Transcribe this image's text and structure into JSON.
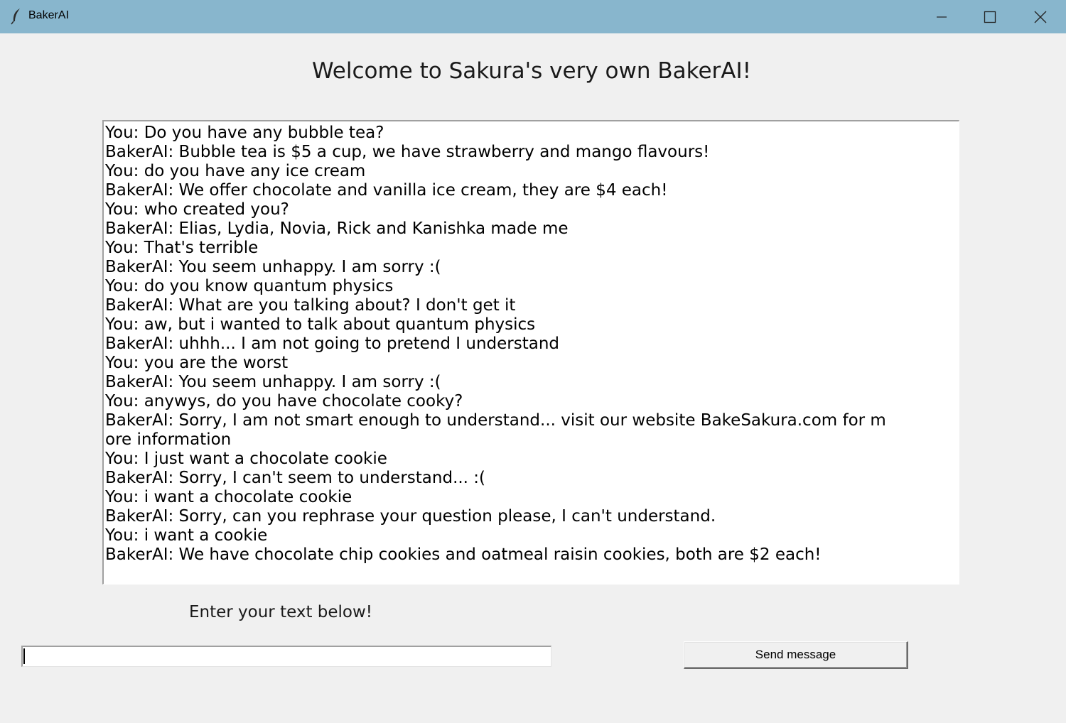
{
  "window": {
    "title": "BakerAI",
    "titlebar_color": "#88b6cd",
    "background": "#f0f0f0"
  },
  "heading": "Welcome to Sakura's very own BakerAI!",
  "chat": {
    "lines": [
      "You: Do you have any bubble tea?",
      "BakerAI: Bubble tea is $5 a cup, we have strawberry and mango flavours!",
      "You: do you have any ice cream",
      "BakerAI: We offer chocolate and vanilla ice cream, they are $4 each!",
      "You: who created you?",
      "BakerAI: Elias, Lydia, Novia, Rick and Kanishka made me",
      "You: That's terrible",
      "BakerAI: You seem unhappy. I am sorry :(",
      "You: do you know quantum physics",
      "BakerAI: What are you talking about? I don't get it",
      "You: aw, but i wanted to talk about quantum physics",
      "BakerAI: uhhh... I am not going to pretend I understand",
      "You: you are the worst",
      "BakerAI: You seem unhappy. I am sorry :(",
      "You: anywys, do you have chocolate cooky?",
      "BakerAI: Sorry, I am not smart enough to understand... visit our website BakeSakura.com for m",
      "ore information",
      "You: I just want a chocolate cookie",
      "BakerAI: Sorry, I can't seem to understand... :(",
      "You: i want a chocolate cookie",
      "BakerAI: Sorry, can you rephrase your question please, I can't understand.",
      "You: i want a cookie",
      "BakerAI: We have chocolate chip cookies and oatmeal raisin cookies, both are $2 each!"
    ]
  },
  "input": {
    "label": "Enter your text below!",
    "value": ""
  },
  "send_button": {
    "label": "Send message"
  },
  "icons": {
    "app": "feather-icon",
    "minimize": "minimize-icon",
    "maximize": "maximize-icon",
    "close": "close-icon"
  }
}
